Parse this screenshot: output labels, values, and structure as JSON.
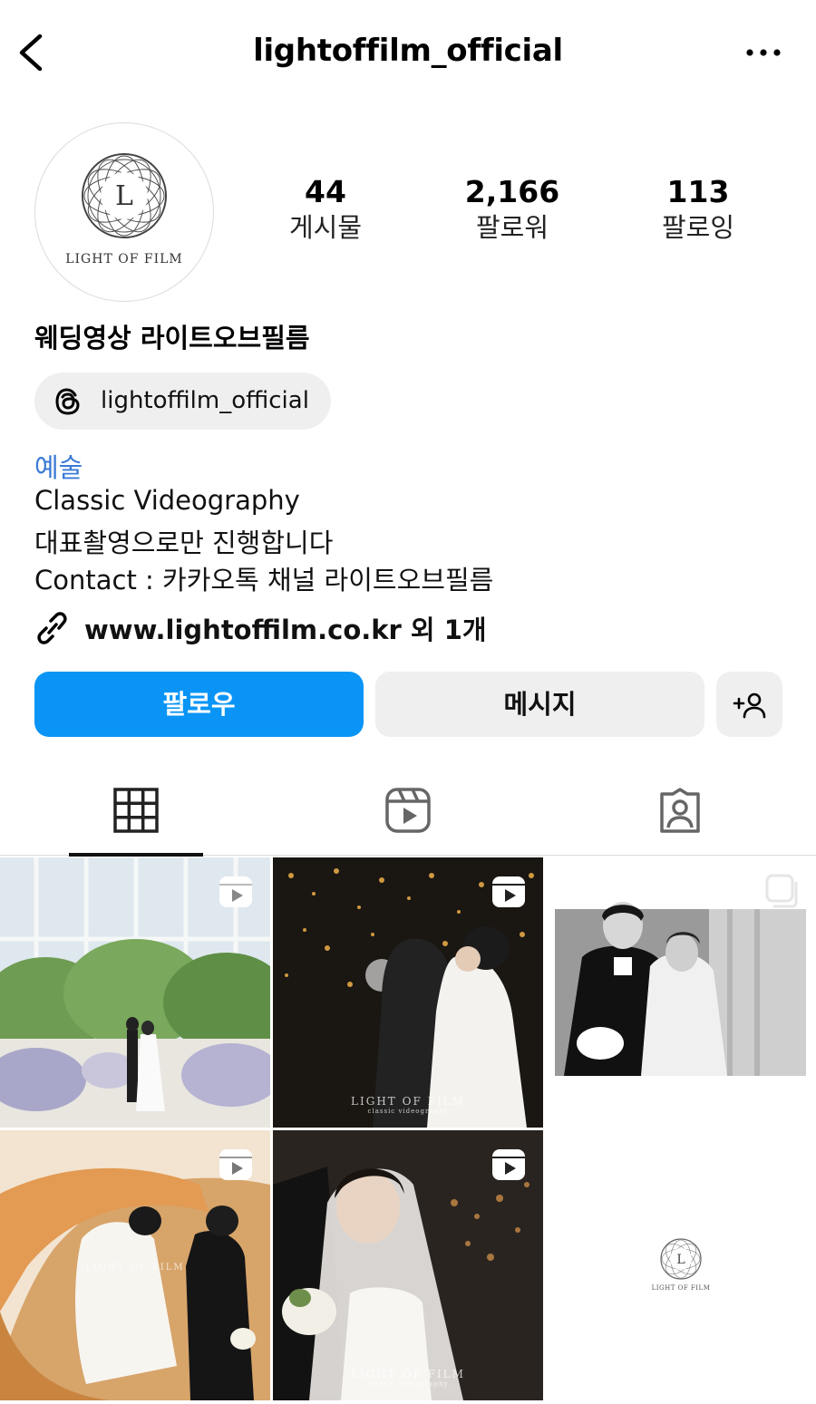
{
  "header": {
    "username": "lightoffilm_official",
    "back_icon": "chevron-left-icon",
    "more_icon": "more-horizontal-icon"
  },
  "profile": {
    "avatar_logo_letter": "L",
    "avatar_logo_text": "LIGHT OF FILM",
    "stats": [
      {
        "value": "44",
        "label": "게시물"
      },
      {
        "value": "2,166",
        "label": "팔로워"
      },
      {
        "value": "113",
        "label": "팔로잉"
      }
    ],
    "display_name": "웨딩영상 라이트오브필름",
    "threads": {
      "icon": "threads-icon",
      "handle": "lightoffilm_official"
    },
    "category": "예술",
    "bio": [
      "Classic Videography",
      "대표촬영으로만 진행합니다",
      "Contact : 카카오톡 채널 라이트오브필름"
    ],
    "link": {
      "icon": "link-icon",
      "text": "www.lightoffilm.co.kr 외 1개"
    }
  },
  "actions": {
    "follow_label": "팔로우",
    "message_label": "메시지",
    "add_user_icon": "add-user-icon",
    "follow_color": "#0A95F6"
  },
  "tabs": [
    {
      "icon": "grid-icon",
      "active": true
    },
    {
      "icon": "reels-icon",
      "active": false
    },
    {
      "icon": "tagged-icon",
      "active": false
    }
  ],
  "posts": [
    {
      "type": "reel",
      "scene": "glass chapel ceremony with flowers"
    },
    {
      "type": "reel",
      "scene": "couple embracing under hanging lights",
      "watermark": "LIGHT OF FILM",
      "watermark_sub": "classic videography"
    },
    {
      "type": "carousel",
      "scene": "black and white couple portrait"
    },
    {
      "type": "reel",
      "scene": "bride and groom on spiral staircase",
      "watermark": "LIGHT OF FILM"
    },
    {
      "type": "reel",
      "scene": "bride smiling with veil and bouquet",
      "watermark": "LIGHT OF FILM",
      "watermark_sub": "classic videography"
    },
    {
      "type": "image",
      "scene": "logo on white",
      "logo_letter": "L",
      "logo_text": "LIGHT OF FILM"
    }
  ]
}
